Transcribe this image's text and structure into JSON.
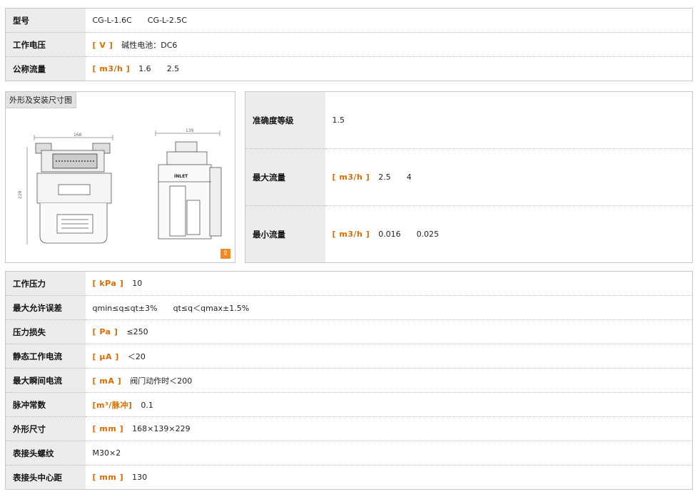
{
  "top_specs": [
    {
      "label": "型号",
      "unit": "",
      "value": "CG-L-1.6C",
      "value2": "CG-L-2.5C"
    },
    {
      "label": "工作电压",
      "unit": "[ V ]",
      "value": "碱性电池：DC6",
      "value2": ""
    },
    {
      "label": "公称流量",
      "unit": "[ m3/h ]",
      "value": "1.6",
      "value2": "2.5"
    }
  ],
  "figure": {
    "title": "外形及安装尺寸图",
    "dim_width_front": "168",
    "dim_width_side": "139",
    "dim_height": "229",
    "inlet_label": "INLET",
    "zoom_icon": "zoom-icon"
  },
  "mid_specs": [
    {
      "label": "准确度等级",
      "unit": "",
      "value": "1.5",
      "value2": ""
    },
    {
      "label": "最大流量",
      "unit": "[ m3/h ]",
      "value": "2.5",
      "value2": "4"
    },
    {
      "label": "最小流量",
      "unit": "[ m3/h ]",
      "value": "0.016",
      "value2": "0.025"
    }
  ],
  "bottom_specs": [
    {
      "label": "工作压力",
      "unit": "[ kPa ]",
      "value": "10",
      "value2": ""
    },
    {
      "label": "最大允许误差",
      "unit": "",
      "value": "qmin≤q≤qt±3%",
      "value2": "qt≤q＜qmax±1.5%"
    },
    {
      "label": "压力损失",
      "unit": "[ Pa ]",
      "value": "≤250",
      "value2": ""
    },
    {
      "label": "静态工作电流",
      "unit": "[ μA ]",
      "value": "＜20",
      "value2": ""
    },
    {
      "label": "最大瞬间电流",
      "unit": "[ mA ]",
      "value": "阀门动作时＜200",
      "value2": ""
    },
    {
      "label": "脉冲常数",
      "unit": "[m³/脉冲]",
      "value": "0.1",
      "value2": ""
    },
    {
      "label": "外形尺寸",
      "unit": "[ mm ]",
      "value": "168×139×229",
      "value2": ""
    },
    {
      "label": "表接头螺纹",
      "unit": "",
      "value": "M30×2",
      "value2": ""
    },
    {
      "label": "表接头中心距",
      "unit": "[ mm ]",
      "value": "130",
      "value2": ""
    }
  ],
  "colors": {
    "accent": "#e06a00",
    "label_bg": "#ececec",
    "border": "#c7c7c7"
  }
}
